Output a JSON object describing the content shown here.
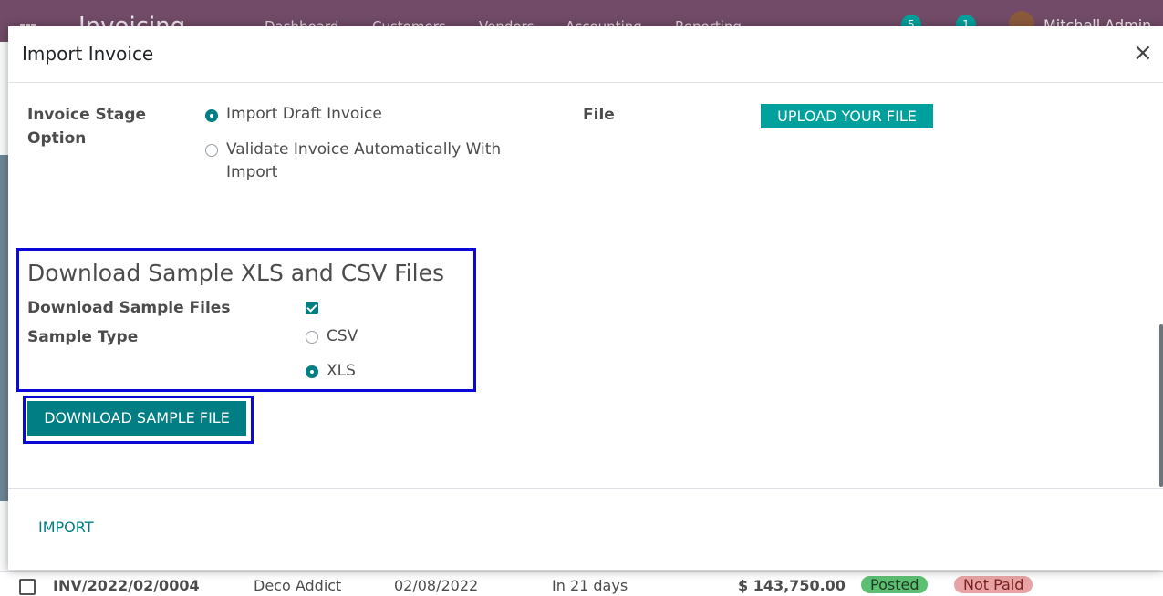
{
  "app": {
    "brand": "Invoicing",
    "menu": [
      "Dashboard",
      "Customers",
      "Vendors",
      "Accounting",
      "Reporting"
    ],
    "messages_count": "5",
    "activities_count": "1",
    "user_name": "Mitchell Admin"
  },
  "background_row": {
    "number": "INV/2022/02/0004",
    "partner": "Deco Addict",
    "date": "02/08/2022",
    "due": "In 21 days",
    "amount": "$ 143,750.00",
    "status": "Posted",
    "payment": "Not Paid"
  },
  "modal": {
    "title": "Import Invoice",
    "close": "×",
    "stage_label_line1": "Invoice Stage",
    "stage_label_line2": "Option",
    "stage_options": [
      "Import Draft Invoice",
      "Validate Invoice Automatically With",
      "Import"
    ],
    "file_label": "File",
    "upload_button": "UPLOAD YOUR FILE",
    "sample_section_title": "Download Sample XLS and CSV Files",
    "download_sample_label": "Download Sample Files",
    "sample_type_label": "Sample Type",
    "sample_options": [
      "CSV",
      "XLS"
    ],
    "selected_sample": "XLS",
    "download_button": "DOWNLOAD SAMPLE FILE",
    "import_button": "IMPORT"
  },
  "colors": {
    "accent": "#017e84",
    "upload": "#00a09d",
    "highlight": "#0b07d6",
    "topbar": "#714b67"
  }
}
